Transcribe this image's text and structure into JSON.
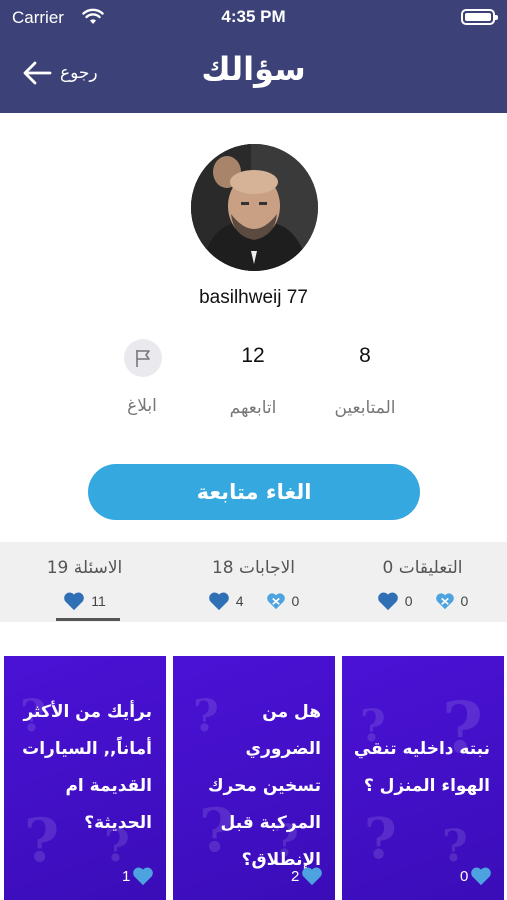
{
  "status_bar": {
    "carrier": "Carrier",
    "time": "4:35 PM"
  },
  "header": {
    "back_label": "رجوع",
    "logo_text": "سؤالك"
  },
  "profile": {
    "username": "basilhweij 77",
    "followers_count": "8",
    "followers_label": "المتابعين",
    "following_count": "12",
    "following_label": "اتابعهم",
    "report_label": "ابلاغ",
    "unfollow_label": "الغاء متابعة"
  },
  "tabs": [
    {
      "title": "التعليقات 0",
      "dislikes": "0",
      "likes": "0"
    },
    {
      "title": "الاجابات 18",
      "dislikes": "0",
      "likes": "4"
    },
    {
      "title": "الاسئلة 19",
      "likes": "11"
    }
  ],
  "cards": [
    {
      "question": "نبته داخليه تنقي الهواء المنزل ؟",
      "likes": "0"
    },
    {
      "question": "هل من الضروري تسخين محرك المركبة قبل الإنطلاق؟",
      "likes": "2"
    },
    {
      "question": "برأيك من الأكثر أماناً,, السيارات القديمة ام الحديثة؟",
      "likes": "1"
    }
  ],
  "colors": {
    "header_bg": "#3c4277",
    "accent_blue": "#35a8e0",
    "card_purple": "#4b12d6",
    "tab_bg": "#f0f0f0"
  },
  "icons": [
    "back-arrow-icon",
    "wifi-icon",
    "battery-icon",
    "flag-icon",
    "heart-icon",
    "broken-heart-icon"
  ]
}
